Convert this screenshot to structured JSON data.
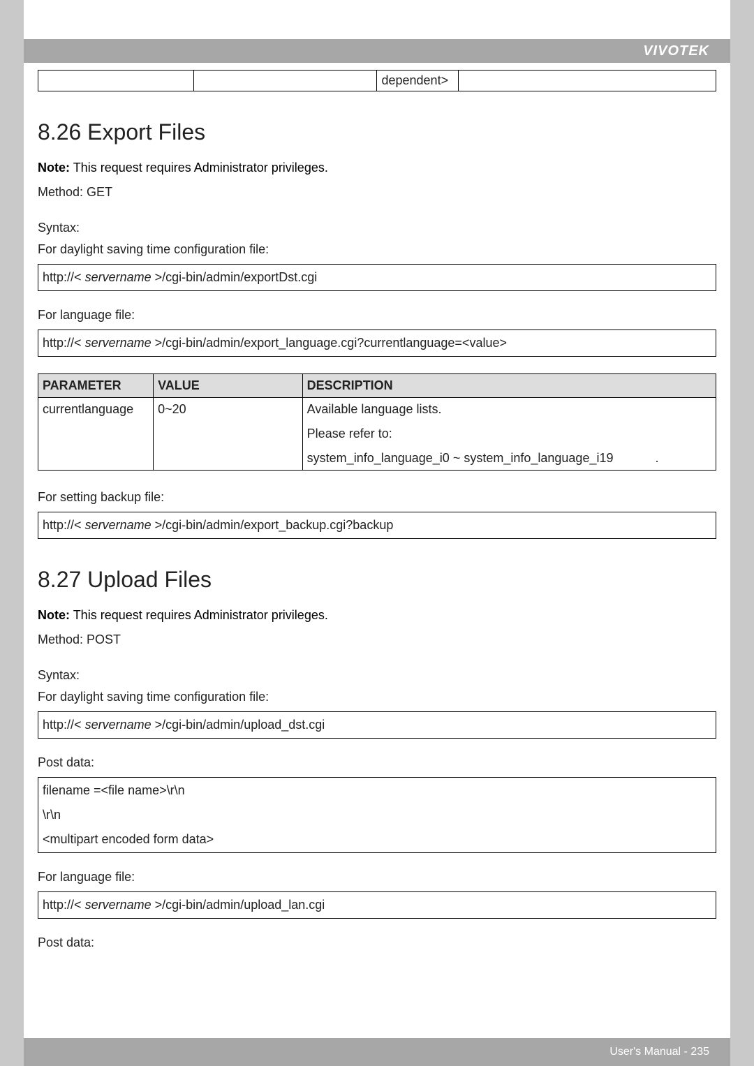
{
  "brand": "VIVOTEK",
  "footer": "User's Manual - 235",
  "top_table": {
    "c3": "dependent>"
  },
  "s826": {
    "heading": "8.26 Export Files",
    "note_label": "Note:",
    "note_text": "This request requires Administrator privileges.",
    "method": "Method: GET",
    "syntax_label": "Syntax:",
    "dst_label": "For daylight saving time configuration file:",
    "dst_url_pre": "http://<",
    "dst_url_srv": "servername",
    "dst_url_post": ">/cgi-bin/admin/exportDst.cgi",
    "lang_label": "For language file:",
    "lang_url_pre": "http://<",
    "lang_url_srv": "servername",
    "lang_url_post": ">/cgi-bin/admin/export_language.cgi?currentlanguage=<value>",
    "param_headers": [
      "PARAMETER",
      "VALUE",
      "DESCRIPTION"
    ],
    "param_row": {
      "param": "currentlanguage",
      "value": "0~20",
      "desc1": "Available language lists.",
      "desc2": "Please refer to:",
      "desc3": "system_info_language_i0 ~ system_info_language_i19"
    },
    "backup_label": "For setting backup file:",
    "backup_url_pre": "http://<",
    "backup_url_srv": "servername",
    "backup_url_post": ">/cgi-bin/admin/export_backup.cgi?backup"
  },
  "s827": {
    "heading": "8.27 Upload Files",
    "note_label": "Note:",
    "note_text": "This request requires Administrator privileges.",
    "method": "Method: POST",
    "syntax_label": "Syntax:",
    "dst_label": "For daylight saving time configuration file:",
    "dst_url_pre": "http://<",
    "dst_url_srv": "servername",
    "dst_url_post": ">/cgi-bin/admin/upload_dst.cgi",
    "postdata_label": "Post data:",
    "post_l1": "filename =<file name>\\r\\n",
    "post_l2": "\\r\\n",
    "post_l3": "<multipart encoded form data>",
    "lang_label": "For language file:",
    "lang_url_pre": "http://<",
    "lang_url_srv": "servername",
    "lang_url_post": ">/cgi-bin/admin/upload_lan.cgi",
    "postdata_label2": "Post data:"
  }
}
